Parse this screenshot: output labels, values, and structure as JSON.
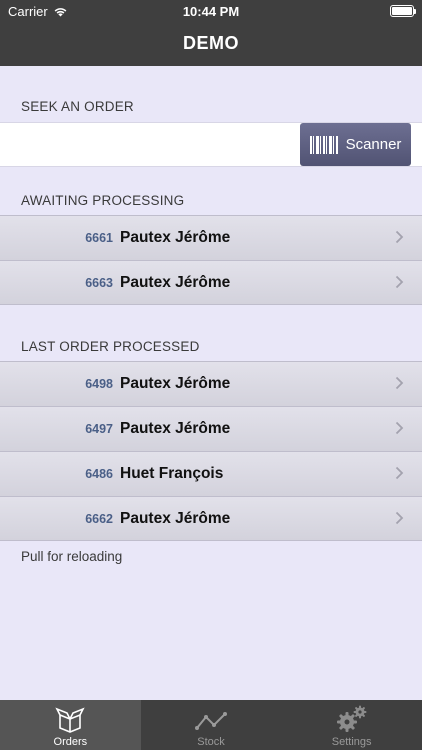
{
  "status": {
    "carrier": "Carrier",
    "time": "10:44 PM"
  },
  "nav": {
    "title": "DEMO"
  },
  "search": {
    "header": "SEEK AN ORDER",
    "placeholder": "",
    "scanner_label": "Scanner"
  },
  "awaiting": {
    "header": "AWAITING PROCESSING",
    "rows": [
      {
        "number": "6661",
        "name": "Pautex Jérôme"
      },
      {
        "number": "6663",
        "name": "Pautex Jérôme"
      }
    ]
  },
  "processed": {
    "header": "LAST ORDER PROCESSED",
    "rows": [
      {
        "number": "6498",
        "name": "Pautex Jérôme"
      },
      {
        "number": "6497",
        "name": "Pautex Jérôme"
      },
      {
        "number": "6486",
        "name": "Huet François"
      },
      {
        "number": "6662",
        "name": "Pautex Jérôme"
      }
    ]
  },
  "footer": {
    "note": "Pull for reloading"
  },
  "tabs": [
    {
      "label": "Orders",
      "icon": "box-icon",
      "active": true
    },
    {
      "label": "Stock",
      "icon": "chart-line-icon",
      "active": false
    },
    {
      "label": "Settings",
      "icon": "gears-icon",
      "active": false
    }
  ],
  "colors": {
    "bar": "#3f3f3f",
    "background": "#e9e7f8",
    "accent": "#5d5f80",
    "order_number": "#4a5f87"
  }
}
